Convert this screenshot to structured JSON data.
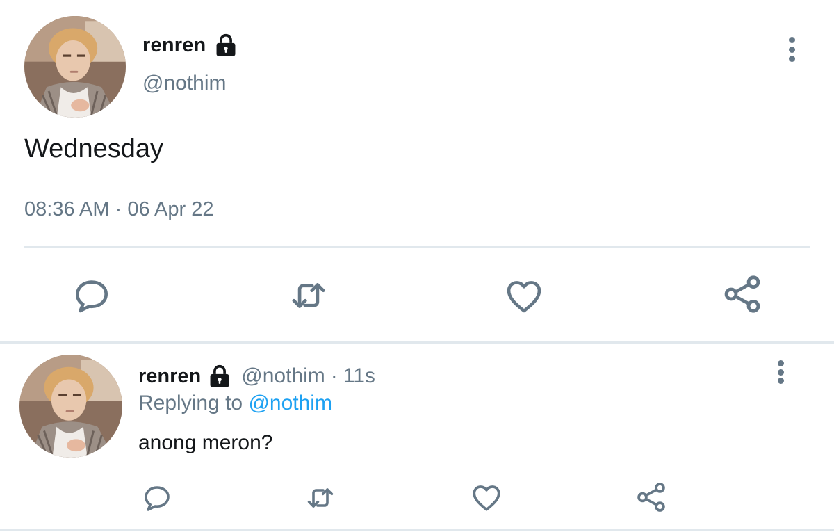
{
  "main_tweet": {
    "name": "renren",
    "handle": "@nothim",
    "text": "Wednesday",
    "time": "08:36 AM",
    "separator": "·",
    "date": "06 Apr 22",
    "lock_icon": "lock-icon",
    "actions": [
      "reply-icon",
      "retweet-icon",
      "like-icon",
      "share-icon"
    ]
  },
  "reply": {
    "name": "renren",
    "handle": "@nothim",
    "dot": "·",
    "time": "11s",
    "replying_prefix": "Replying to",
    "replying_handle": "@nothim",
    "text": "anong meron?",
    "lock_icon": "lock-icon",
    "actions": [
      "reply-icon",
      "retweet-icon",
      "like-icon",
      "share-icon"
    ]
  },
  "colors": {
    "text_primary": "#14171a",
    "text_secondary": "#657786",
    "link": "#1da1f2",
    "divider": "#e1e8ed",
    "background": "#ffffff"
  }
}
